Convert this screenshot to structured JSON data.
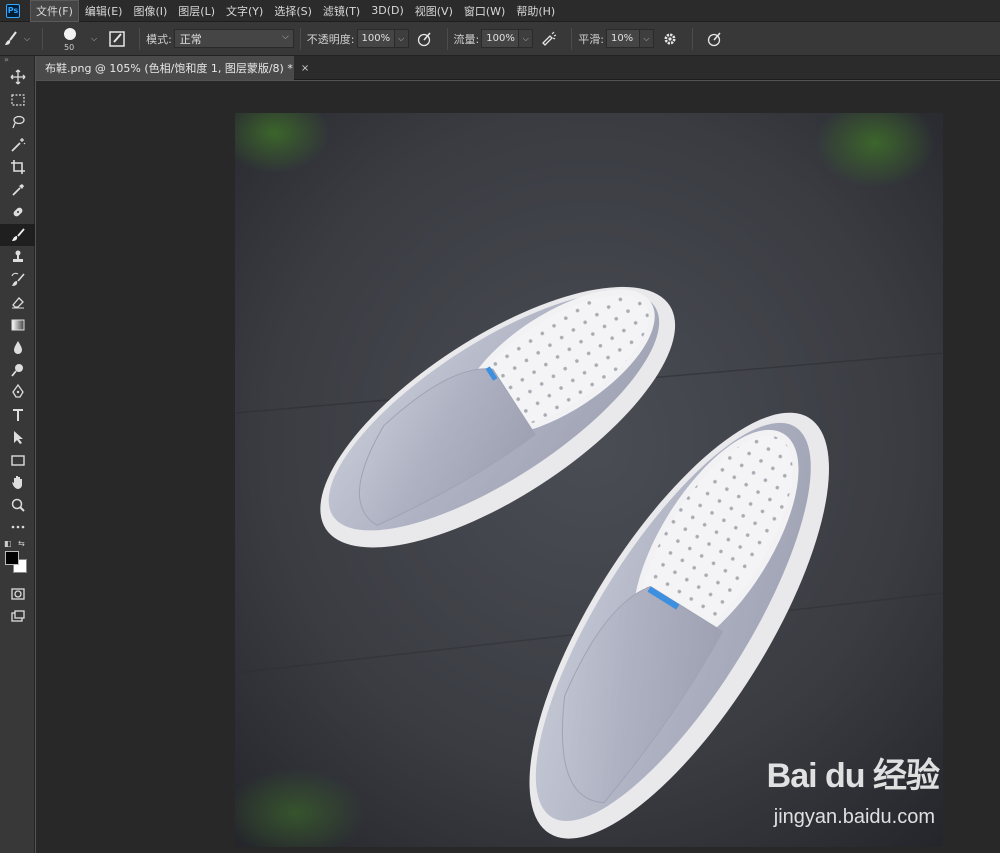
{
  "app": {
    "logo": "Ps"
  },
  "menu": {
    "items": [
      "文件(F)",
      "编辑(E)",
      "图像(I)",
      "图层(L)",
      "文字(Y)",
      "选择(S)",
      "滤镜(T)",
      "3D(D)",
      "视图(V)",
      "窗口(W)",
      "帮助(H)"
    ]
  },
  "options": {
    "brush_size": "50",
    "mode_label": "模式:",
    "mode_value": "正常",
    "opacity_label": "不透明度:",
    "opacity_value": "100%",
    "flow_label": "流量:",
    "flow_value": "100%",
    "smoothing_label": "平滑:",
    "smoothing_value": "10%"
  },
  "document": {
    "tab_title": "布鞋.png @ 105% (色相/饱和度 1, 图层蒙版/8) *",
    "close_glyph": "×"
  },
  "toolbar": {
    "tools": [
      "move-icon",
      "marquee-icon",
      "lasso-icon",
      "magic-wand-icon",
      "crop-icon",
      "eyedropper-icon",
      "healing-brush-icon",
      "brush-icon",
      "clone-stamp-icon",
      "history-brush-icon",
      "eraser-icon",
      "gradient-icon",
      "blur-icon",
      "dodge-icon",
      "pen-icon",
      "type-icon",
      "path-select-icon",
      "rectangle-icon",
      "hand-icon",
      "zoom-icon",
      "more-tools-icon"
    ],
    "active_tool": "brush-icon",
    "foreground_color": "#000000",
    "background_color": "#ffffff"
  },
  "watermark": {
    "logo_text": "Bai du 经验",
    "url": "jingyan.baidu.com"
  },
  "colors": {
    "menubar_bg": "#2b2b2b",
    "panel_bg": "#383838",
    "workspace_bg": "#282828",
    "accent": "#31a8ff"
  }
}
